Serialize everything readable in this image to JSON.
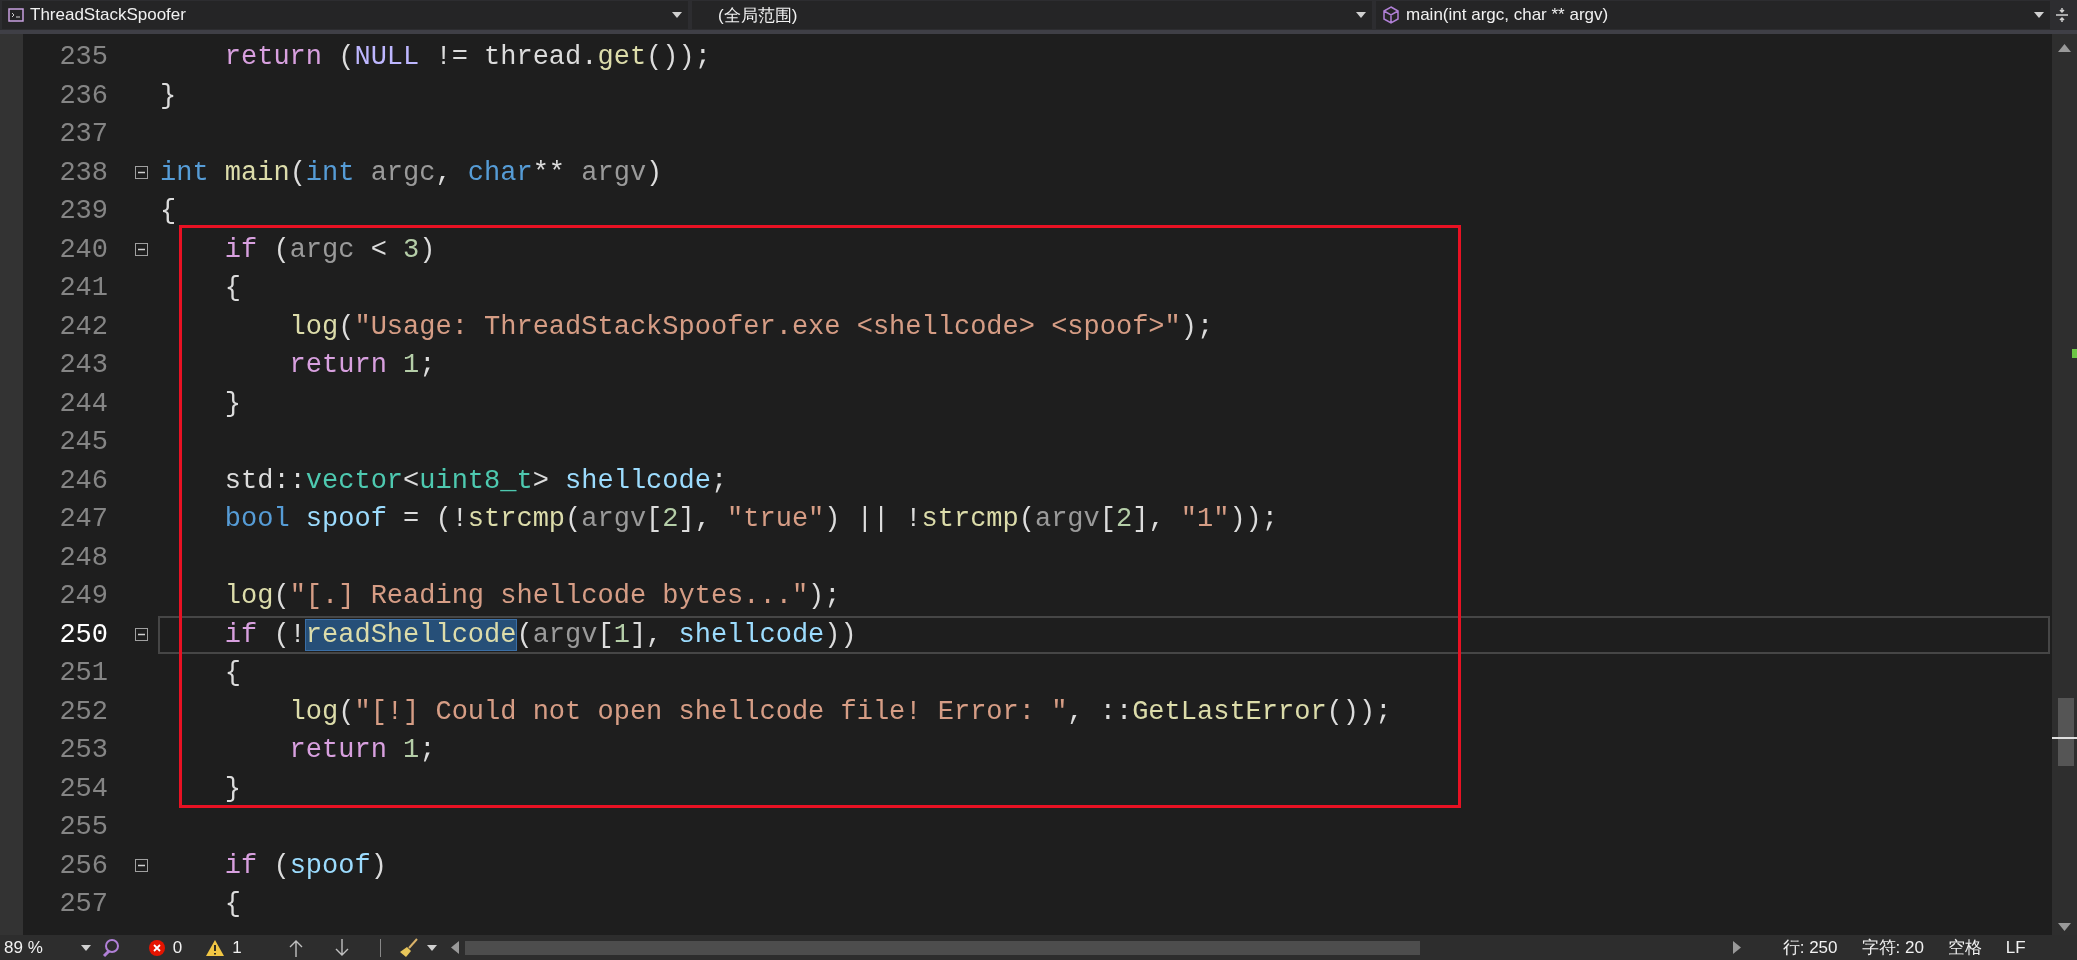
{
  "navigation_bar": {
    "project": "ThreadStackSpoofer",
    "scope": "(全局范围)",
    "member": "main(int argc, char ** argv)"
  },
  "editor": {
    "blocks": [
      {
        "boxed": false,
        "lines": [
          {
            "number": "235",
            "current": false,
            "collapsible": false,
            "tokens": [
              {
                "kind": "keyword",
                "text": "    return"
              },
              {
                "kind": "plain",
                "text": " ("
              },
              {
                "kind": "macro",
                "text": "NULL"
              },
              {
                "kind": "plain",
                "text": " != thread."
              },
              {
                "kind": "function",
                "text": "get"
              },
              {
                "kind": "plain",
                "text": "());"
              }
            ]
          },
          {
            "number": "236",
            "current": false,
            "collapsible": false,
            "tokens": [
              {
                "kind": "plain",
                "text": "}"
              }
            ]
          },
          {
            "number": "237",
            "current": false,
            "collapsible": false
          },
          {
            "number": "238",
            "current": false,
            "collapsible": true,
            "tokens": [
              {
                "kind": "type",
                "text": "int"
              },
              {
                "kind": "function",
                "text": " main"
              },
              {
                "kind": "plain",
                "text": "("
              },
              {
                "kind": "type",
                "text": "int"
              },
              {
                "kind": "param",
                "text": " argc"
              },
              {
                "kind": "plain",
                "text": ", "
              },
              {
                "kind": "type",
                "text": "char"
              },
              {
                "kind": "plain",
                "text": "** "
              },
              {
                "kind": "param",
                "text": "argv"
              },
              {
                "kind": "plain",
                "text": ")"
              }
            ]
          },
          {
            "number": "239",
            "current": false,
            "collapsible": false,
            "tokens": [
              {
                "kind": "plain",
                "text": "{"
              }
            ]
          }
        ]
      },
      {
        "boxed": true,
        "lines": [
          {
            "number": "240",
            "current": false,
            "collapsible": true,
            "tokens": [
              {
                "kind": "keyword",
                "text": "    if"
              },
              {
                "kind": "plain",
                "text": " ("
              },
              {
                "kind": "param",
                "text": "argc"
              },
              {
                "kind": "plain",
                "text": " < "
              },
              {
                "kind": "number",
                "text": "3"
              },
              {
                "kind": "plain",
                "text": ")"
              }
            ]
          },
          {
            "number": "241",
            "current": false,
            "collapsible": false,
            "tokens": [
              {
                "kind": "plain",
                "text": "    {"
              }
            ]
          },
          {
            "number": "242",
            "current": false,
            "collapsible": false,
            "tokens": [
              {
                "kind": "function",
                "text": "        log"
              },
              {
                "kind": "plain",
                "text": "("
              },
              {
                "kind": "string",
                "text": "\"Usage: ThreadStackSpoofer.exe <shellcode> <spoof>\""
              },
              {
                "kind": "plain",
                "text": ");"
              }
            ]
          },
          {
            "number": "243",
            "current": false,
            "collapsible": false,
            "tokens": [
              {
                "kind": "keyword",
                "text": "        return"
              },
              {
                "kind": "number",
                "text": " 1"
              },
              {
                "kind": "plain",
                "text": ";"
              }
            ]
          },
          {
            "number": "244",
            "current": false,
            "collapsible": false,
            "tokens": [
              {
                "kind": "plain",
                "text": "    }"
              }
            ]
          },
          {
            "number": "245",
            "current": false,
            "collapsible": false
          },
          {
            "number": "246",
            "current": false,
            "collapsible": false,
            "tokens": [
              {
                "kind": "plain",
                "text": "    std::"
              },
              {
                "kind": "class",
                "text": "vector"
              },
              {
                "kind": "plain",
                "text": "<"
              },
              {
                "kind": "class",
                "text": "uint8_t"
              },
              {
                "kind": "plain",
                "text": "> "
              },
              {
                "kind": "variable",
                "text": "shellcode"
              },
              {
                "kind": "plain",
                "text": ";"
              }
            ]
          },
          {
            "number": "247",
            "current": false,
            "collapsible": false,
            "tokens": [
              {
                "kind": "type",
                "text": "    bool"
              },
              {
                "kind": "variable",
                "text": " spoof"
              },
              {
                "kind": "plain",
                "text": " = (!"
              },
              {
                "kind": "function",
                "text": "strcmp"
              },
              {
                "kind": "plain",
                "text": "("
              },
              {
                "kind": "param",
                "text": "argv"
              },
              {
                "kind": "plain",
                "text": "["
              },
              {
                "kind": "number",
                "text": "2"
              },
              {
                "kind": "plain",
                "text": "], "
              },
              {
                "kind": "string",
                "text": "\"true\""
              },
              {
                "kind": "plain",
                "text": ") || !"
              },
              {
                "kind": "function",
                "text": "strcmp"
              },
              {
                "kind": "plain",
                "text": "("
              },
              {
                "kind": "param",
                "text": "argv"
              },
              {
                "kind": "plain",
                "text": "["
              },
              {
                "kind": "number",
                "text": "2"
              },
              {
                "kind": "plain",
                "text": "], "
              },
              {
                "kind": "string",
                "text": "\"1\""
              },
              {
                "kind": "plain",
                "text": "));"
              }
            ]
          },
          {
            "number": "248",
            "current": false,
            "collapsible": false
          },
          {
            "number": "249",
            "current": false,
            "collapsible": false,
            "tokens": [
              {
                "kind": "function",
                "text": "    log"
              },
              {
                "kind": "plain",
                "text": "("
              },
              {
                "kind": "string",
                "text": "\"[.] Reading shellcode bytes...\""
              },
              {
                "kind": "plain",
                "text": ");"
              }
            ]
          },
          {
            "number": "250",
            "current": true,
            "collapsible": true,
            "tokens": [
              {
                "kind": "keyword",
                "text": "    if"
              },
              {
                "kind": "plain",
                "text": " (!"
              },
              {
                "kind": "selected",
                "text": "readShellcode"
              },
              {
                "kind": "plain",
                "text": "("
              },
              {
                "kind": "param",
                "text": "argv"
              },
              {
                "kind": "plain",
                "text": "["
              },
              {
                "kind": "number",
                "text": "1"
              },
              {
                "kind": "plain",
                "text": "], "
              },
              {
                "kind": "variable",
                "text": "shellcode"
              },
              {
                "kind": "plain",
                "text": "))"
              }
            ]
          },
          {
            "number": "251",
            "current": false,
            "collapsible": false,
            "tokens": [
              {
                "kind": "plain",
                "text": "    {"
              }
            ]
          },
          {
            "number": "252",
            "current": false,
            "collapsible": false,
            "tokens": [
              {
                "kind": "function",
                "text": "        log"
              },
              {
                "kind": "plain",
                "text": "("
              },
              {
                "kind": "string",
                "text": "\"[!] Could not open shellcode file! Error: \""
              },
              {
                "kind": "plain",
                "text": ", ::"
              },
              {
                "kind": "function",
                "text": "GetLastError"
              },
              {
                "kind": "plain",
                "text": "());"
              }
            ]
          },
          {
            "number": "253",
            "current": false,
            "collapsible": false,
            "tokens": [
              {
                "kind": "keyword",
                "text": "        return"
              },
              {
                "kind": "number",
                "text": " 1"
              },
              {
                "kind": "plain",
                "text": ";"
              }
            ]
          },
          {
            "number": "254",
            "current": false,
            "collapsible": false,
            "tokens": [
              {
                "kind": "plain",
                "text": "    }"
              }
            ]
          }
        ]
      },
      {
        "boxed": false,
        "lines": [
          {
            "number": "255",
            "current": false,
            "collapsible": false
          },
          {
            "number": "256",
            "current": false,
            "collapsible": true,
            "tokens": [
              {
                "kind": "keyword",
                "text": "    if"
              },
              {
                "kind": "plain",
                "text": " ("
              },
              {
                "kind": "variable",
                "text": "spoof"
              },
              {
                "kind": "plain",
                "text": ")"
              }
            ]
          },
          {
            "number": "257",
            "current": false,
            "collapsible": false,
            "tokens": [
              {
                "kind": "plain",
                "text": "    {"
              }
            ]
          }
        ]
      }
    ]
  },
  "status_bar": {
    "zoom": "89 %",
    "errors": "0",
    "warnings": "1",
    "line": "行: 250",
    "column": "字符: 20",
    "indentation": "空格",
    "line_ending": "LF"
  }
}
